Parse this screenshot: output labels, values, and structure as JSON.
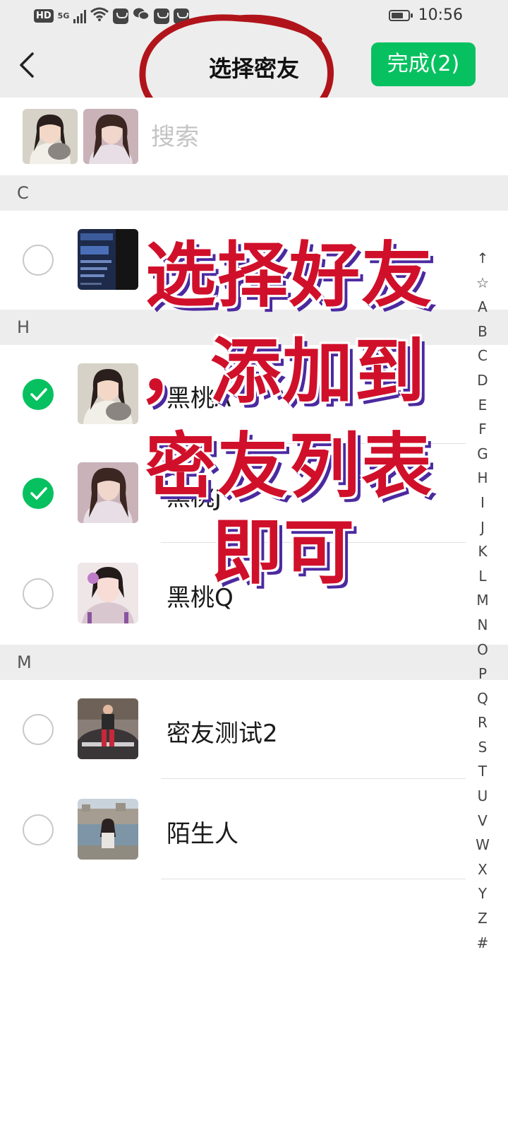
{
  "status_bar": {
    "network_hd": "HD",
    "network_5g": "5G",
    "time": "10:56"
  },
  "nav": {
    "title": "选择密友",
    "done_label": "完成(2)"
  },
  "search": {
    "placeholder": "搜索"
  },
  "sections": [
    {
      "letter": "C",
      "contacts": [
        {
          "name": "",
          "checked": false,
          "avatar": "privacy-poster"
        }
      ]
    },
    {
      "letter": "H",
      "contacts": [
        {
          "name": "黑桃A",
          "checked": true,
          "avatar": "girl-with-cat"
        },
        {
          "name": "黑桃J",
          "checked": true,
          "avatar": "girl-long-hair"
        },
        {
          "name": "黑桃Q",
          "checked": false,
          "avatar": "girl-pink"
        }
      ]
    },
    {
      "letter": "M",
      "contacts": [
        {
          "name": "密友测试2",
          "checked": false,
          "avatar": "man-car"
        },
        {
          "name": "陌生人",
          "checked": false,
          "avatar": "girl-castle"
        }
      ]
    }
  ],
  "index_letters": [
    "↑",
    "☆",
    "A",
    "B",
    "C",
    "D",
    "E",
    "F",
    "G",
    "H",
    "I",
    "J",
    "K",
    "L",
    "M",
    "N",
    "O",
    "P",
    "Q",
    "R",
    "S",
    "T",
    "U",
    "V",
    "W",
    "X",
    "Y",
    "Z",
    "#"
  ],
  "overlay": {
    "line1": "选择好友",
    "line2": "，添加到",
    "line3": "密友列表",
    "line4": "即可"
  },
  "colors": {
    "accent_green": "#07c160",
    "overlay_red": "#d0102a",
    "overlay_shadow": "#4b2aa0",
    "annotation_circle": "#b0141a",
    "header_gray": "#ededed"
  }
}
